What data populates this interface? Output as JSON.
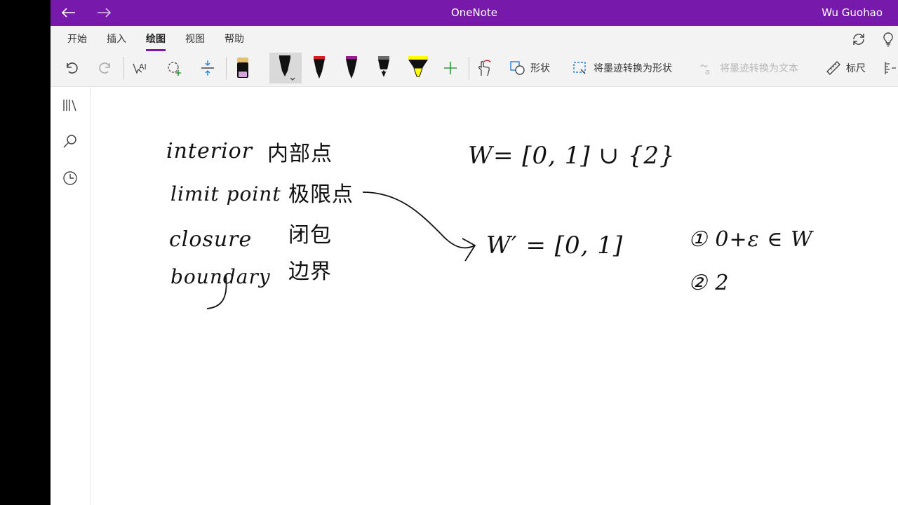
{
  "app": {
    "title": "OneNote",
    "user": "Wu Guohao"
  },
  "ribbon": {
    "tabs": [
      "开始",
      "插入",
      "绘图",
      "视图",
      "帮助"
    ],
    "active_tab": "绘图",
    "actions": {
      "shapes": "形状",
      "ink_to_shape": "将墨迹转换为形状",
      "ink_to_text": "将墨迹转换为文本",
      "ruler": "标尺"
    },
    "pens": [
      {
        "name": "pen-black",
        "color": "#111111"
      },
      {
        "name": "pen-red",
        "color": "#d42020"
      },
      {
        "name": "pen-purple",
        "color": "#9b1c8f"
      },
      {
        "name": "pencil-gray",
        "color": "#6b6b6b"
      },
      {
        "name": "highlighter-yellow",
        "color": "#ffff00"
      }
    ],
    "eraser_color": "#d4a5d9",
    "add_color": "#2e9a3a"
  },
  "notes": {
    "terms": [
      {
        "en": "interior",
        "zh": "内部点"
      },
      {
        "en": "limit point",
        "zh": "极限点"
      },
      {
        "en": "closure",
        "zh": "闭包"
      },
      {
        "en": "boundary",
        "zh": "边界"
      }
    ],
    "w_def": "W=  [0, 1]  ∪  {2}",
    "w_prime_def": "W′ =  [0, 1]",
    "item1": "① 0+ε ∈ W",
    "item2": "② 2"
  },
  "colors": {
    "accent": "#7719aa",
    "ribbon_bg": "#f3f3f3",
    "ink": "#111111"
  }
}
